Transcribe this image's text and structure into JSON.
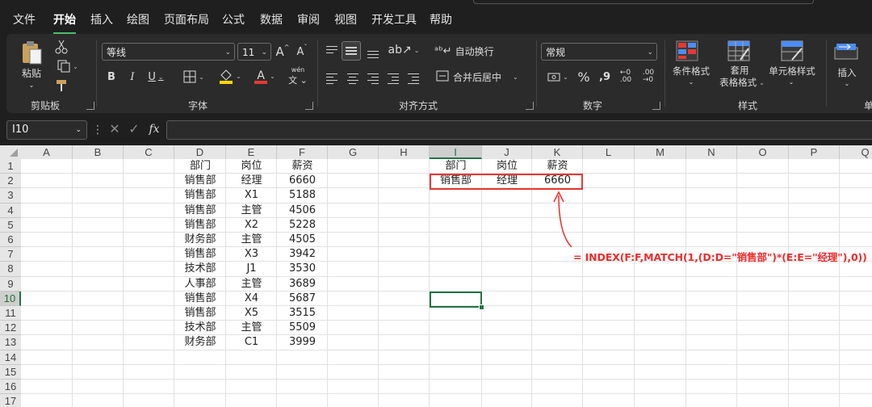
{
  "menu": {
    "items": [
      "文件",
      "开始",
      "插入",
      "绘图",
      "页面布局",
      "公式",
      "数据",
      "审阅",
      "视图",
      "开发工具",
      "帮助"
    ],
    "active": "开始"
  },
  "ribbon": {
    "clipboard": {
      "paste_label": "粘贴",
      "group_label": "剪贴板"
    },
    "font": {
      "font_name": "等线",
      "font_size": "11",
      "bold": "B",
      "italic": "I",
      "underline": "U",
      "grow": "A",
      "shrink": "A",
      "font_color_letter": "A",
      "phonetic": "wén",
      "group_label": "字体"
    },
    "alignment": {
      "wrap_text": "自动换行",
      "merge_center": "合并后居中",
      "group_label": "对齐方式"
    },
    "number": {
      "format": "常规",
      "percent": "%",
      "comma": "9",
      "group_label": "数字"
    },
    "styles": {
      "conditional": "条件格式",
      "table_format_1": "套用",
      "table_format_2": "表格格式",
      "cell_styles": "单元格样式",
      "group_label": "样式"
    },
    "cells": {
      "insert": "插入",
      "group_label_partial": "单"
    }
  },
  "formula_bar": {
    "name_box": "I10",
    "fx": "fx",
    "formula": ""
  },
  "sheet": {
    "columns": [
      "A",
      "B",
      "C",
      "D",
      "E",
      "F",
      "G",
      "H",
      "I",
      "J",
      "K",
      "L",
      "M",
      "N",
      "O",
      "P",
      "Q"
    ],
    "rows": [
      "1",
      "2",
      "3",
      "4",
      "5",
      "6",
      "7",
      "8",
      "9",
      "10",
      "11",
      "12",
      "13",
      "14",
      "15",
      "16",
      "17"
    ],
    "selected_col": "I",
    "selected_row": "10",
    "table_headers": [
      "部门",
      "岗位",
      "薪资"
    ],
    "table_rows": [
      [
        "销售部",
        "经理",
        "6660"
      ],
      [
        "销售部",
        "X1",
        "5188"
      ],
      [
        "销售部",
        "主管",
        "4506"
      ],
      [
        "销售部",
        "X2",
        "5228"
      ],
      [
        "财务部",
        "主管",
        "4505"
      ],
      [
        "销售部",
        "X3",
        "3942"
      ],
      [
        "技术部",
        "J1",
        "3530"
      ],
      [
        "人事部",
        "主管",
        "3689"
      ],
      [
        "销售部",
        "X4",
        "5687"
      ],
      [
        "销售部",
        "X5",
        "3515"
      ],
      [
        "技术部",
        "主管",
        "5509"
      ],
      [
        "财务部",
        "C1",
        "3999"
      ]
    ],
    "lookup_headers": [
      "部门",
      "岗位",
      "薪资"
    ],
    "lookup_values": [
      "销售部",
      "经理",
      "6660"
    ],
    "annotation": "=  INDEX(F:F,MATCH(1,(D:D=\"销售部\")*(E:E=\"经理\"),0))"
  },
  "colors": {
    "accent": "#217346",
    "highlight_red": "#e53935",
    "annotation_red": "#ee2b2b"
  }
}
